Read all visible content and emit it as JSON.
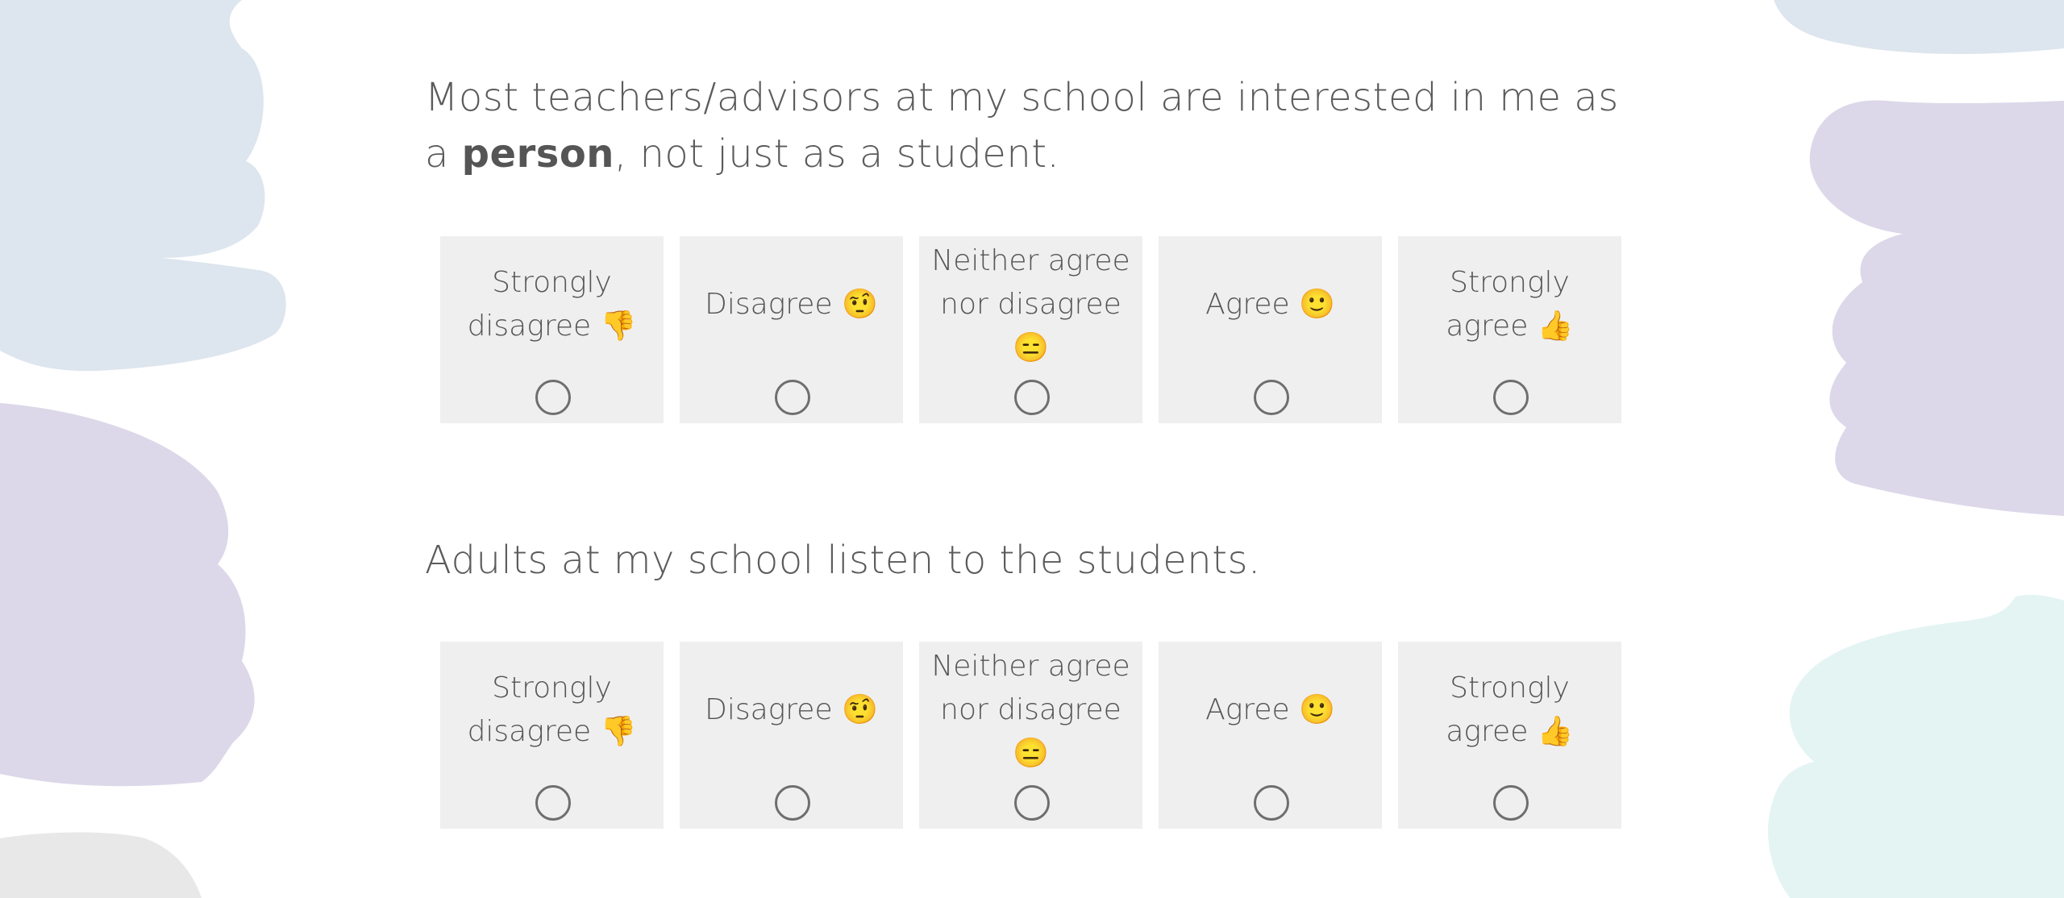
{
  "questions": [
    {
      "text_before": "Most teachers/advisors at my school are interested in me as a ",
      "text_bold": "person",
      "text_after": ", not just as a student.",
      "options": [
        {
          "label": "Strongly disagree 👎"
        },
        {
          "label": "Disagree 🤨"
        },
        {
          "label": "Neither agree nor disagree 😑"
        },
        {
          "label": "Agree 🙂"
        },
        {
          "label": "Strongly agree 👍"
        }
      ]
    },
    {
      "text": "Adults at my school listen to the students.",
      "options": [
        {
          "label": "Strongly disagree 👎"
        },
        {
          "label": "Disagree 🤨"
        },
        {
          "label": "Neither agree nor disagree 😑"
        },
        {
          "label": "Agree 🙂"
        },
        {
          "label": "Strongly agree 👍"
        }
      ]
    }
  ],
  "colors": {
    "blob_blue": "#dde5ee",
    "blob_purple": "#dcd8e9",
    "blob_gray": "#e8e8e8",
    "blob_teal": "#e3f4f3",
    "option_bg": "#efefef",
    "text": "#555555"
  }
}
